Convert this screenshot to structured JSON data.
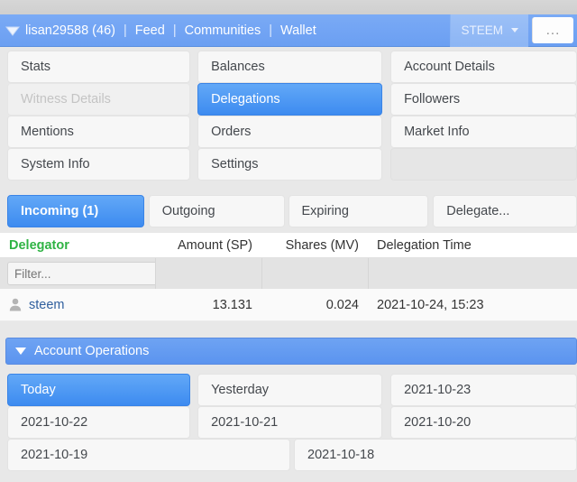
{
  "navbar": {
    "caret_icon": "caret-down-icon",
    "username": "lisan29588 (46)",
    "separator": "|",
    "links": [
      "Feed",
      "Communities",
      "Wallet"
    ],
    "currency_select": "STEEM",
    "more_label": "...",
    "bg_color": "#6b9ff2"
  },
  "menu": {
    "rows": [
      [
        {
          "label": "Stats",
          "state": "normal"
        },
        {
          "label": "Balances",
          "state": "normal"
        },
        {
          "label": "Account Details",
          "state": "normal"
        }
      ],
      [
        {
          "label": "Witness Details",
          "state": "disabled"
        },
        {
          "label": "Delegations",
          "state": "active"
        },
        {
          "label": "Followers",
          "state": "normal"
        }
      ],
      [
        {
          "label": "Mentions",
          "state": "normal"
        },
        {
          "label": "Orders",
          "state": "normal"
        },
        {
          "label": "Market Info",
          "state": "normal"
        }
      ],
      [
        {
          "label": "System Info",
          "state": "normal"
        },
        {
          "label": "Settings",
          "state": "normal"
        },
        {
          "label": "",
          "state": "empty"
        }
      ]
    ],
    "active_color": "#3d8bf0"
  },
  "tabs": [
    {
      "label": "Incoming (1)",
      "state": "active"
    },
    {
      "label": "Outgoing",
      "state": "normal"
    },
    {
      "label": "Expiring",
      "state": "normal"
    },
    {
      "label": "Delegate...",
      "state": "normal"
    }
  ],
  "table": {
    "columns": [
      "Delegator",
      "Amount (SP)",
      "Shares (MV)",
      "Delegation Time"
    ],
    "sorted_column": "Delegator",
    "sorted_color": "#2fb344",
    "filter_placeholder": "Filter...",
    "filter_value": "",
    "rows": [
      {
        "icon": "person-icon",
        "delegator": "steem",
        "amount_sp": "13.131",
        "shares_mv": "0.024",
        "delegation_time": "2021-10-24, 15:23"
      }
    ]
  },
  "operations": {
    "caret_icon": "caret-down-icon",
    "title": "Account Operations",
    "bg_color": "#5b94ef",
    "rows": [
      [
        {
          "label": "Today",
          "state": "active"
        },
        {
          "label": "Yesterday",
          "state": "normal"
        },
        {
          "label": "2021-10-23",
          "state": "normal"
        }
      ],
      [
        {
          "label": "2021-10-22",
          "state": "normal"
        },
        {
          "label": "2021-10-21",
          "state": "normal"
        },
        {
          "label": "2021-10-20",
          "state": "normal"
        }
      ]
    ],
    "last_row": [
      {
        "label": "2021-10-19",
        "state": "normal"
      },
      {
        "label": "2021-10-18",
        "state": "normal"
      }
    ]
  }
}
